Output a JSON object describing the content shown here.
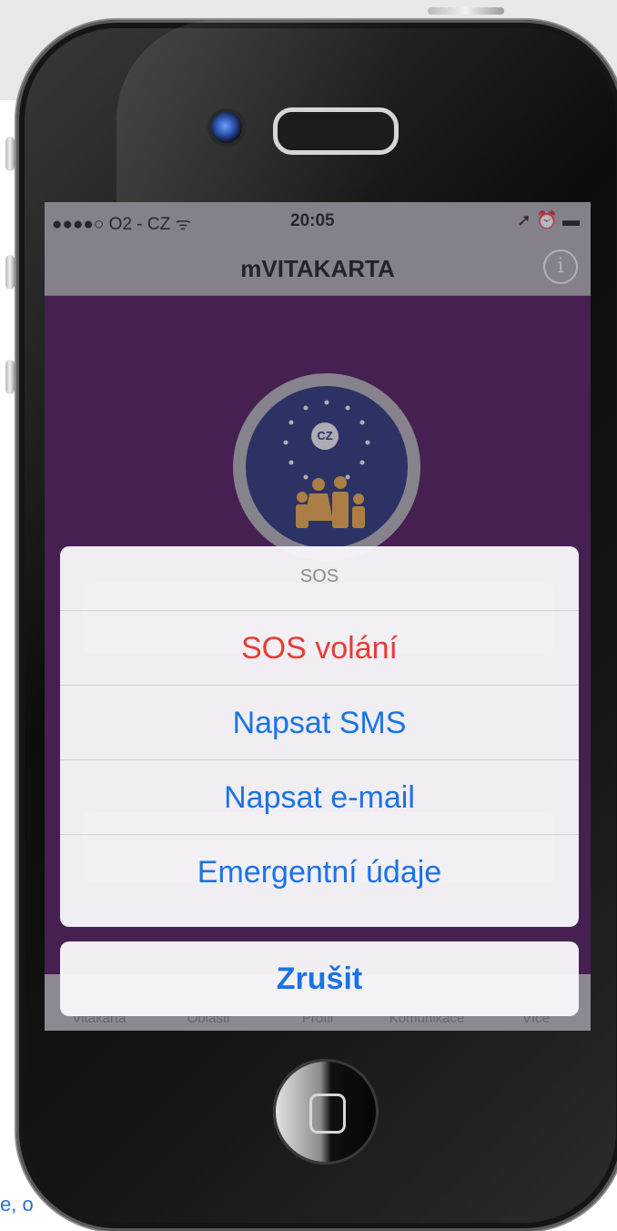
{
  "background": {
    "snippet_text": "e, o"
  },
  "status_bar": {
    "carrier": "●●●●○ O2 - CZ ᯤ",
    "time": "20:05",
    "icons": "➚ ⏰ ▬"
  },
  "nav": {
    "title": "mVITAKARTA",
    "info_icon": "info-icon",
    "info_glyph": "i"
  },
  "logo": {
    "badge": "CZ"
  },
  "action_sheet": {
    "title": "SOS",
    "options": [
      "SOS volání",
      "Napsat SMS",
      "Napsat e-mail",
      "Emergentní údaje"
    ],
    "cancel": "Zrušit"
  },
  "tab_bar": {
    "tabs": [
      "Vitakarta",
      "Oblasti",
      "Profil",
      "Komunikace",
      "Více"
    ]
  },
  "colors": {
    "accent": "#1a73e6",
    "danger": "#ea3b32",
    "app_background": "#45124e",
    "bar_gray": "#a7a7a7"
  }
}
